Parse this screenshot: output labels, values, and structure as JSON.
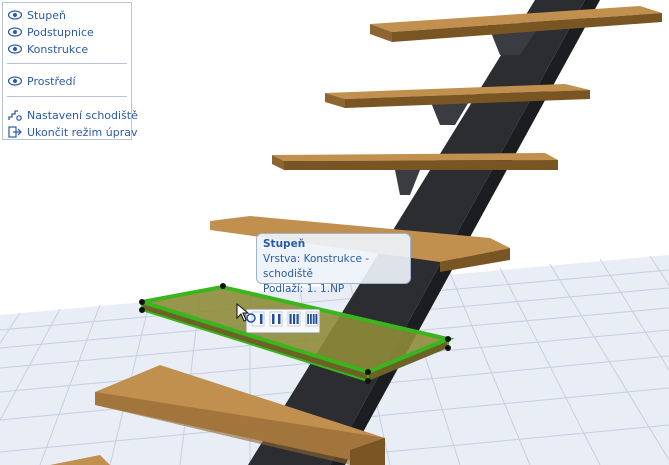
{
  "panel": {
    "items": [
      {
        "label": "Stupeň",
        "icon": "eye-icon"
      },
      {
        "label": "Podstupnice",
        "icon": "eye-icon"
      },
      {
        "label": "Konstrukce",
        "icon": "eye-icon"
      },
      {
        "label": "Prostředí",
        "icon": "eye-icon"
      },
      {
        "label": "Nastavení schodiště",
        "icon": "stair-settings-icon"
      },
      {
        "label": "Ukončit režim úprav",
        "icon": "exit-icon"
      }
    ]
  },
  "tooltip": {
    "title": "Stupeň",
    "layer": "Vrstva: Konstrukce - schodiště",
    "story": "Podlaží: 1. 1.NP"
  },
  "toolbar": {
    "buttons": [
      {
        "icon": "tread-one-edge-icon"
      },
      {
        "icon": "tread-two-edges-icon"
      },
      {
        "icon": "tread-three-edges-icon"
      },
      {
        "icon": "tread-four-edges-icon"
      }
    ]
  },
  "colors": {
    "wood": "#b98845",
    "wood_dark": "#7a5524",
    "stringer": "#2b2d31",
    "selection": "#3ab51d",
    "link_blue": "#2a5aa8",
    "grid_line": "#c3cde0"
  }
}
